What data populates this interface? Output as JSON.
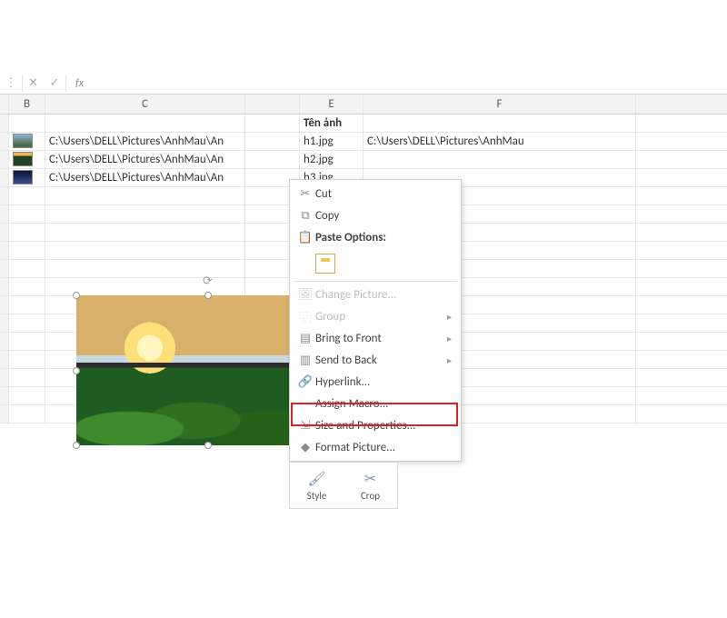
{
  "formula_bar": {
    "fx_label": "fx"
  },
  "columns": {
    "B": "B",
    "C": "C",
    "D": "",
    "E": "E",
    "F": "F"
  },
  "headers": {
    "E": "Tên ảnh"
  },
  "rows": [
    {
      "b": "th1",
      "c": "C:\\Users\\DELL\\Pictures\\AnhMau\\An",
      "e": "h1.jpg",
      "f": "C:\\Users\\DELL\\Pictures\\AnhMau"
    },
    {
      "b": "th2",
      "c": "C:\\Users\\DELL\\Pictures\\AnhMau\\An",
      "e": "h2.jpg",
      "f": ""
    },
    {
      "b": "th3",
      "c": "C:\\Users\\DELL\\Pictures\\AnhMau\\An",
      "e": "h3.jpg",
      "f": ""
    }
  ],
  "context_menu": {
    "cut": "Cut",
    "copy": "Copy",
    "paste_options_header": "Paste Options:",
    "change_picture": "Change Picture...",
    "group": "Group",
    "bring_to_front": "Bring to Front",
    "send_to_back": "Send to Back",
    "hyperlink": "Hyperlink...",
    "assign_macro": "Assign Macro...",
    "size_and_properties": "Size and Properties...",
    "format_picture": "Format Picture..."
  },
  "mini_toolbar": {
    "style": "Style",
    "crop": "Crop"
  },
  "icons": {
    "scissors": "✂",
    "copy": "⧉",
    "clipboard": "📋",
    "picture": "🖼",
    "group": "⿻",
    "front": "▤",
    "back": "▥",
    "link": "🔗",
    "size": "⇲",
    "format": "◆",
    "rotate": "⟳",
    "style": "🖌",
    "crop": "✂",
    "cancel": "✕",
    "confirm": "✓",
    "dots": "⋮"
  }
}
